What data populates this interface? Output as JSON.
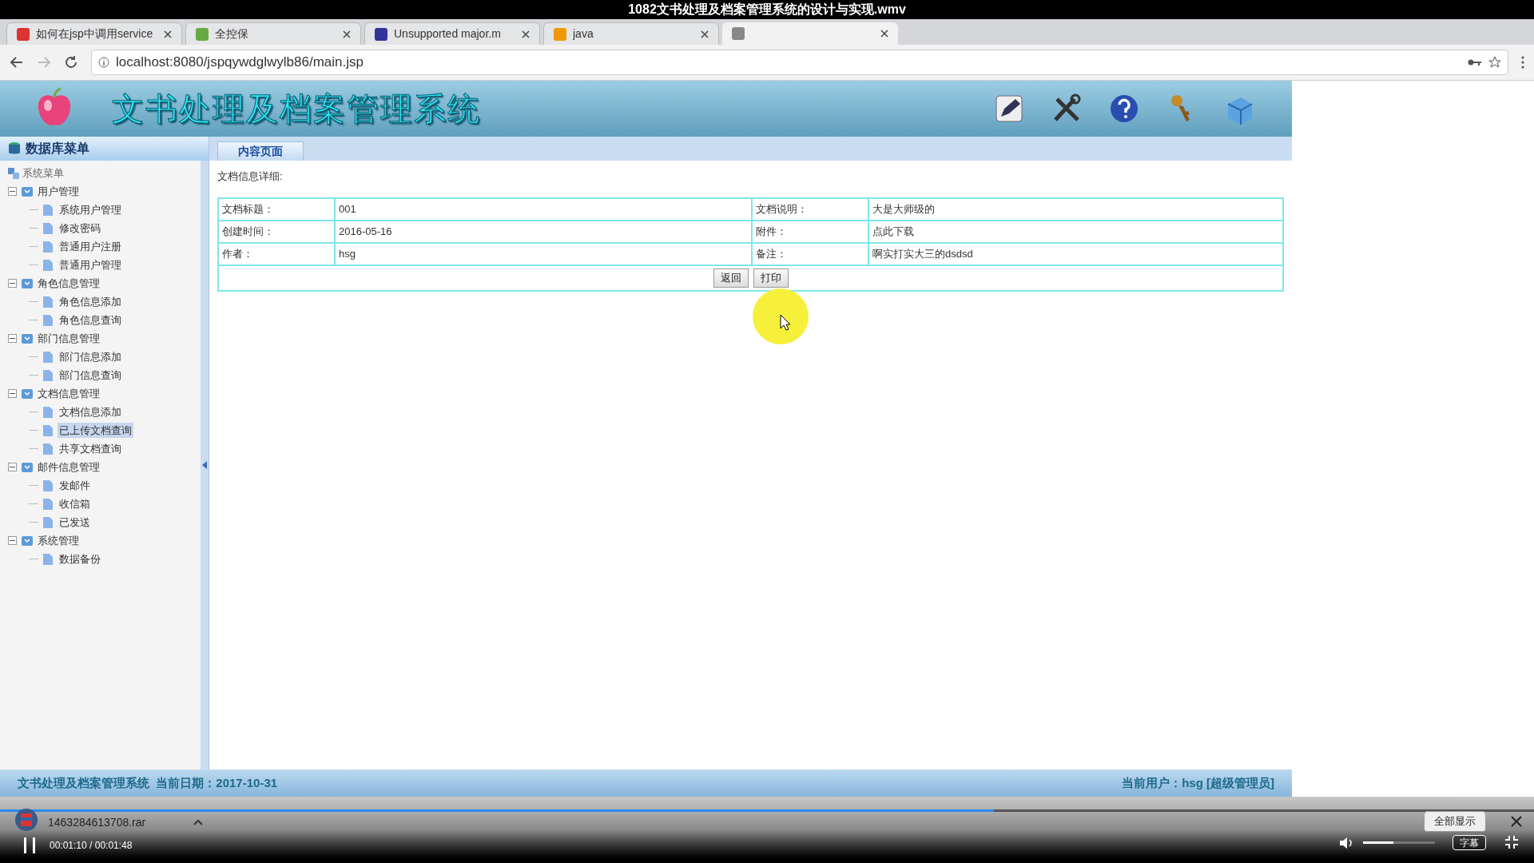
{
  "video": {
    "title": "1082文书处理及档案管理系统的设计与实现.wmv",
    "time": "00:01:10 / 00:01:48",
    "progress": {
      "level": 0.648
    },
    "volume": {
      "level": 0.42
    },
    "subtitle_button": "字幕"
  },
  "browser": {
    "tabs": [
      {
        "label": "如何在jsp中调用service",
        "selected": false
      },
      {
        "label": "全控保",
        "selected": false
      },
      {
        "label": "Unsupported major.m",
        "selected": false
      },
      {
        "label": "java",
        "selected": false
      },
      {
        "selected": true
      }
    ],
    "url": "localhost:8080/jspqywdglwylb86/main.jsp"
  },
  "app": {
    "title": "文书处理及档案管理系统",
    "sidebar_title": "数据库菜单",
    "tree_root": "系统菜单",
    "menu": [
      {
        "label": "用户管理",
        "expanded": true,
        "children": [
          {
            "label": "系统用户管理",
            "selected": false
          },
          {
            "label": "修改密码",
            "selected": false
          },
          {
            "label": "普通用户注册",
            "selected": false
          },
          {
            "label": "普通用户管理",
            "selected": false
          }
        ]
      },
      {
        "label": "角色信息管理",
        "expanded": true,
        "children": [
          {
            "label": "角色信息添加",
            "selected": false
          },
          {
            "label": "角色信息查询",
            "selected": false
          }
        ]
      },
      {
        "label": "部门信息管理",
        "expanded": true,
        "children": [
          {
            "label": "部门信息添加",
            "selected": false
          },
          {
            "label": "部门信息查询",
            "selected": false
          }
        ]
      },
      {
        "label": "文档信息管理",
        "expanded": true,
        "children": [
          {
            "label": "文档信息添加",
            "selected": false
          },
          {
            "label": "已上传文档查询",
            "selected": true
          },
          {
            "label": "共享文档查询",
            "selected": false
          }
        ]
      },
      {
        "label": "邮件信息管理",
        "expanded": true,
        "children": [
          {
            "label": "发邮件",
            "selected": false
          },
          {
            "label": "收信箱",
            "selected": false
          },
          {
            "label": "已发送",
            "selected": false
          }
        ]
      },
      {
        "label": "系统管理",
        "expanded": true,
        "children": [
          {
            "label": "数据备份",
            "selected": false
          }
        ]
      }
    ],
    "content_tab": "内容页面",
    "section_title": "文档信息详细:",
    "details": [
      [
        "文档标题：",
        "001",
        "文档说明：",
        "大是大师级的"
      ],
      [
        "创建时间：",
        "2016-05-16",
        "附件：",
        "点此下载"
      ],
      [
        "作者：",
        "hsg",
        "备注：",
        "啊实打实大三的dsdsd"
      ]
    ],
    "buttons": [
      "返回",
      "打印"
    ],
    "status_left": "文书处理及档案管理系统  当前日期：2017-10-31",
    "status_right": "当前用户：hsg [超级管理员]"
  },
  "downloads": {
    "file": "1463284613708.rar",
    "show_all": "全部显示"
  }
}
